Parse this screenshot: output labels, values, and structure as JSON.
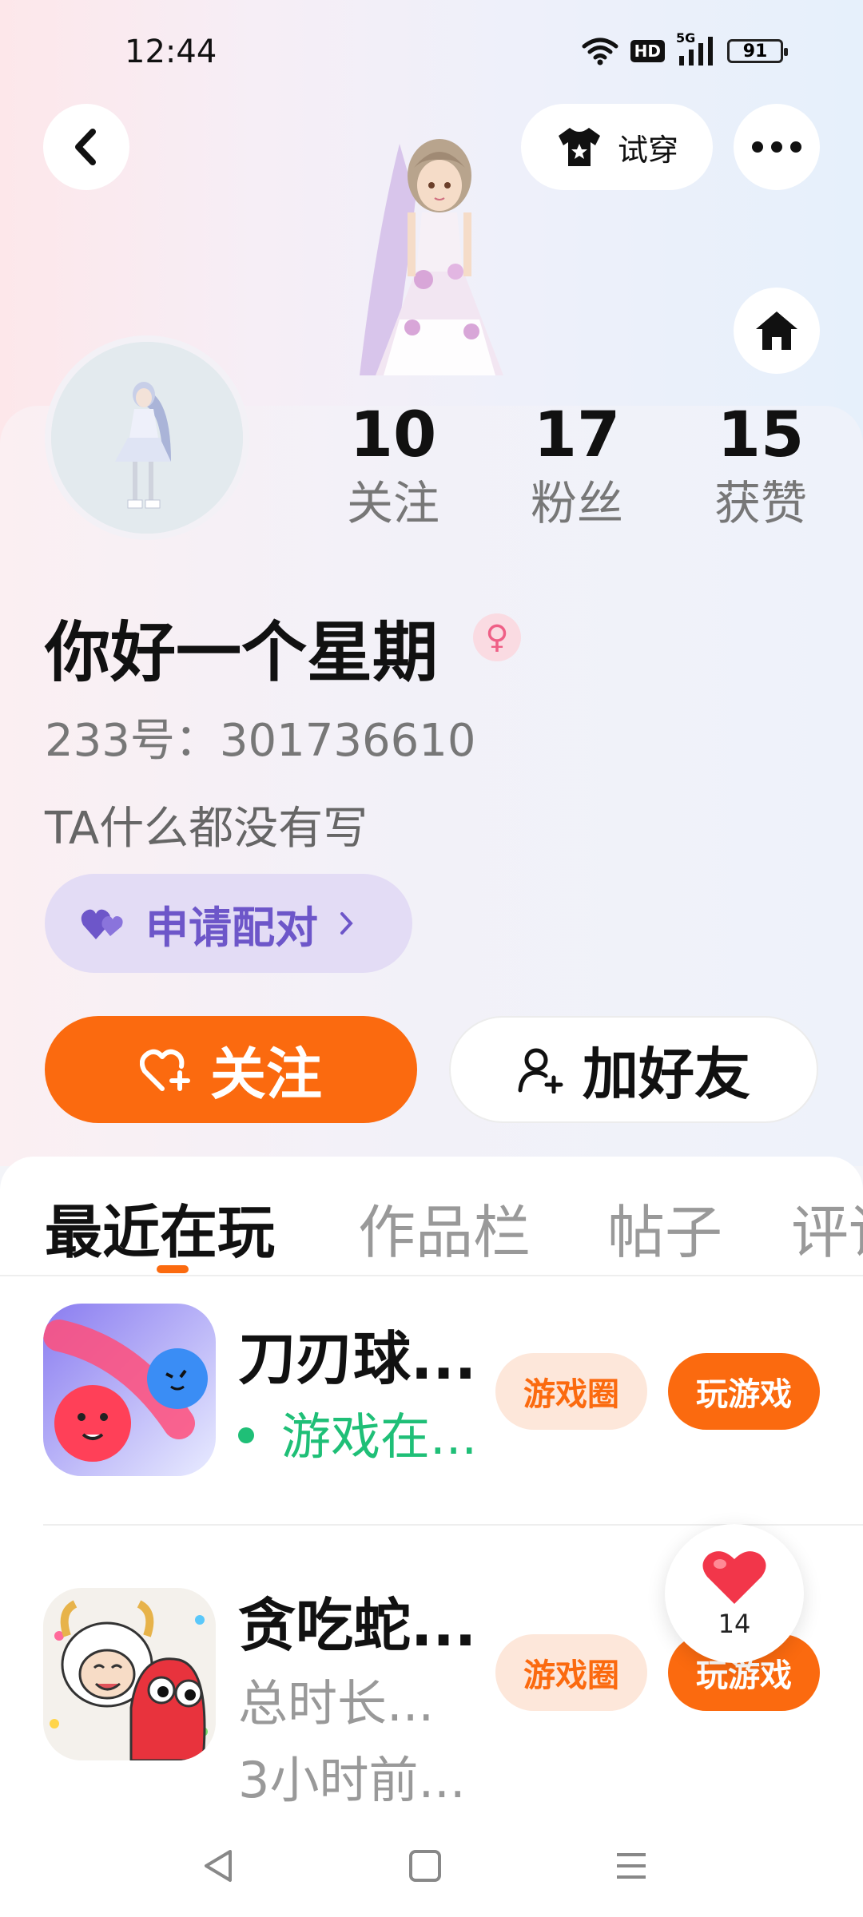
{
  "status_bar": {
    "time": "12:44",
    "network": "5G",
    "hd": "HD",
    "battery": "91"
  },
  "header": {
    "try_on_label": "试穿"
  },
  "profile": {
    "stats": [
      {
        "value": "10",
        "label": "关注"
      },
      {
        "value": "17",
        "label": "粉丝"
      },
      {
        "value": "15",
        "label": "获赞"
      }
    ],
    "nickname": "你好一个星期",
    "gender_symbol": "♀",
    "uid": "233号：301736610",
    "bio": "TA什么都没有写",
    "pair_button": "申请配对",
    "follow_button": "关注",
    "add_friend_button": "加好友"
  },
  "tabs": [
    {
      "label": "最近在玩",
      "active": true
    },
    {
      "label": "作品栏",
      "active": false
    },
    {
      "label": "帖子",
      "active": false
    },
    {
      "label": "评论",
      "active": false
    }
  ],
  "games": [
    {
      "title": "刀刃球...",
      "line1": "游戏在...",
      "line2": "",
      "online": true,
      "circle_button": "游戏圈",
      "play_button": "玩游戏"
    },
    {
      "title": "贪吃蛇...",
      "line1": "总时长...",
      "line2": "3小时前...",
      "online": false,
      "circle_button": "游戏圈",
      "play_button": "玩游戏"
    }
  ],
  "like_float": {
    "count": "14"
  },
  "colors": {
    "accent": "#fb6a0f",
    "pair_purple": "#6d56c9",
    "online_green": "#1fbf77"
  }
}
